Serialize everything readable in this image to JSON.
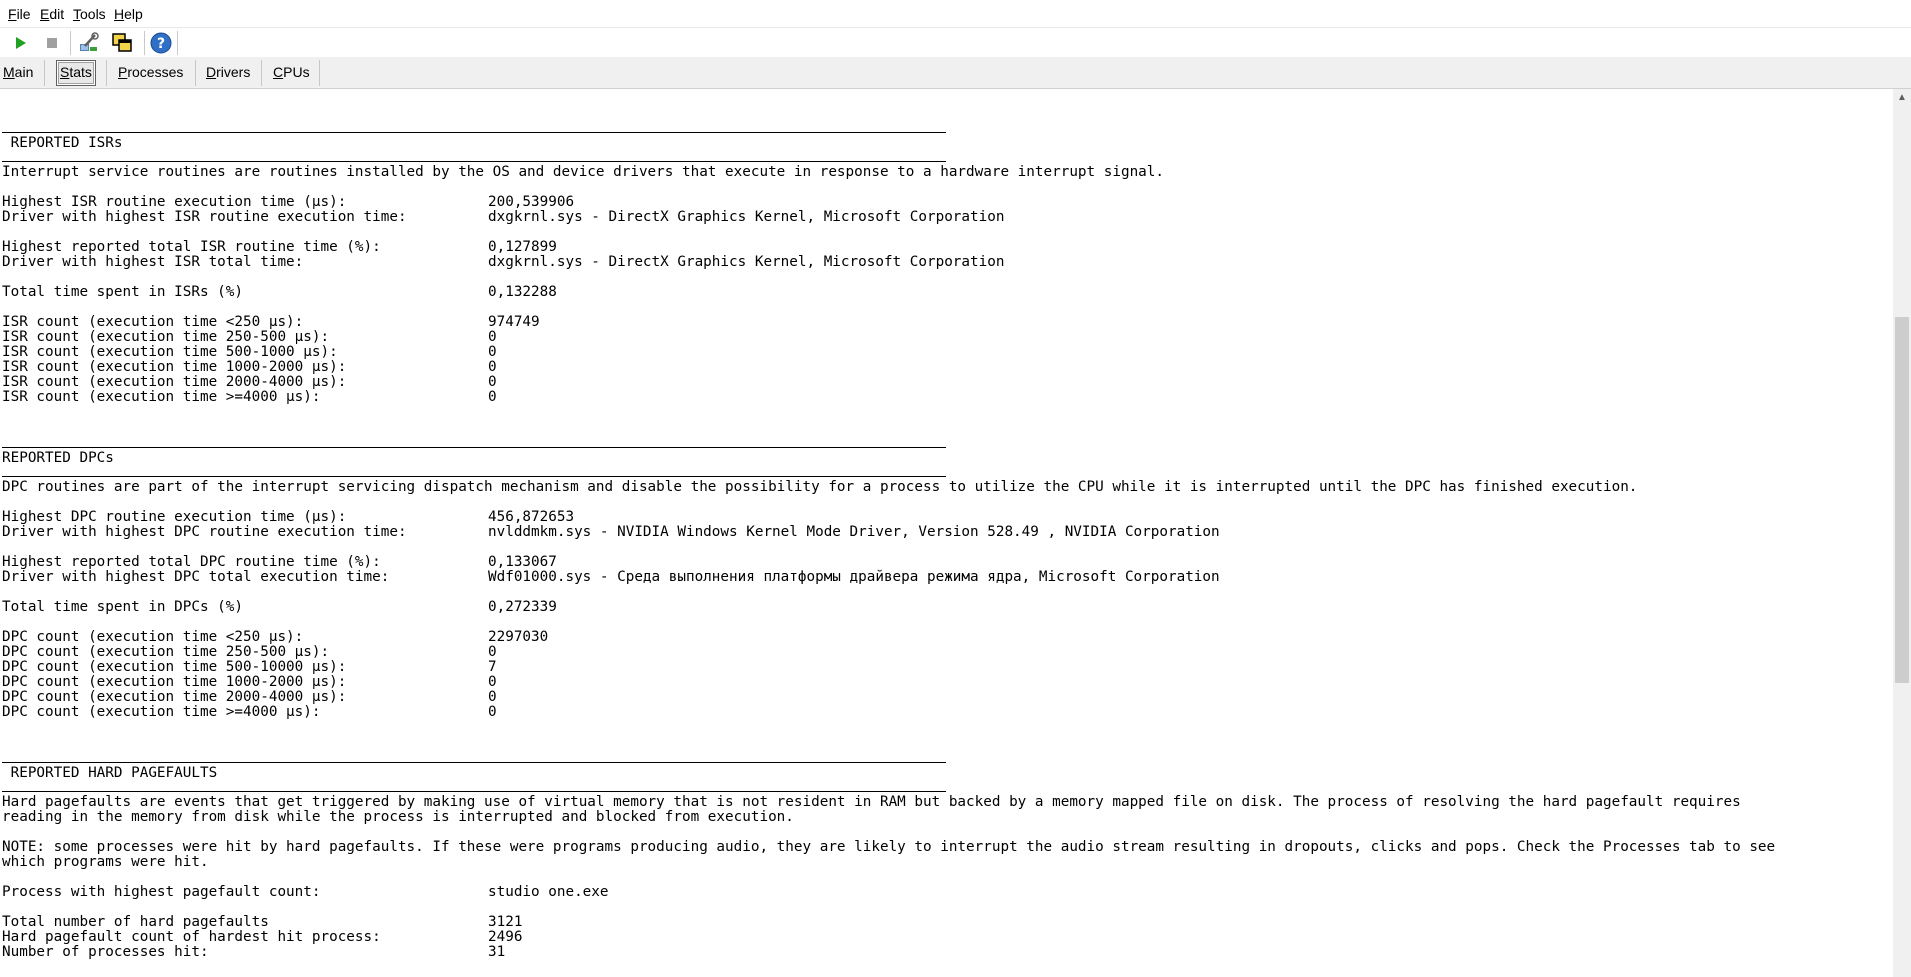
{
  "menu": {
    "file": {
      "accel": "F",
      "rest": "ile"
    },
    "edit": {
      "accel": "E",
      "rest": "dit"
    },
    "tools": {
      "accel": "T",
      "rest": "ools"
    },
    "help": {
      "accel": "H",
      "rest": "elp"
    }
  },
  "tabs": [
    {
      "accel": "M",
      "rest": "ain"
    },
    {
      "accel": "S",
      "rest": "tats"
    },
    {
      "accel": "P",
      "rest": "rocesses"
    },
    {
      "accel": "D",
      "rest": "rivers"
    },
    {
      "accel": "C",
      "rest": "PUs"
    }
  ],
  "isr": {
    "header": " REPORTED ISRs",
    "description": "Interrupt service routines are routines installed by the OS and device drivers that execute in response to a hardware interrupt signal.",
    "rows": [
      {
        "label": "Highest ISR routine execution time (µs):",
        "value": "200,539906"
      },
      {
        "label": "Driver with highest ISR routine execution time:",
        "value": "dxgkrnl.sys - DirectX Graphics Kernel, Microsoft Corporation"
      },
      {
        "label": "Highest reported total ISR routine time (%):",
        "value": "0,127899"
      },
      {
        "label": "Driver with highest ISR total time:",
        "value": "dxgkrnl.sys - DirectX Graphics Kernel, Microsoft Corporation"
      },
      {
        "label": "Total time spent in ISRs (%)",
        "value": "0,132288"
      },
      {
        "label": "ISR count (execution time <250 µs):",
        "value": "974749"
      },
      {
        "label": "ISR count (execution time 250-500 µs):",
        "value": "0"
      },
      {
        "label": "ISR count (execution time 500-1000 µs):",
        "value": "0"
      },
      {
        "label": "ISR count (execution time 1000-2000 µs):",
        "value": "0"
      },
      {
        "label": "ISR count (execution time 2000-4000 µs):",
        "value": "0"
      },
      {
        "label": "ISR count (execution time >=4000 µs):",
        "value": "0"
      }
    ]
  },
  "dpc": {
    "header": "REPORTED DPCs",
    "description": "DPC routines are part of the interrupt servicing dispatch mechanism and disable the possibility for a process to utilize the CPU while it is interrupted until the DPC has finished execution.",
    "rows": [
      {
        "label": "Highest DPC routine execution time (µs):",
        "value": "456,872653"
      },
      {
        "label": "Driver with highest DPC routine execution time:",
        "value": "nvlddmkm.sys - NVIDIA Windows Kernel Mode Driver, Version 528.49 , NVIDIA Corporation"
      },
      {
        "label": "Highest reported total DPC routine time (%):",
        "value": "0,133067"
      },
      {
        "label": "Driver with highest DPC total execution time:",
        "value": "Wdf01000.sys - Среда выполнения платформы драйвера режима ядра, Microsoft Corporation"
      },
      {
        "label": "Total time spent in DPCs (%)",
        "value": "0,272339"
      },
      {
        "label": "DPC count (execution time <250 µs):",
        "value": "2297030"
      },
      {
        "label": "DPC count (execution time 250-500 µs):",
        "value": "0"
      },
      {
        "label": "DPC count (execution time 500-10000 µs):",
        "value": "7"
      },
      {
        "label": "DPC count (execution time 1000-2000 µs):",
        "value": "0"
      },
      {
        "label": "DPC count (execution time 2000-4000 µs):",
        "value": "0"
      },
      {
        "label": "DPC count (execution time >=4000 µs):",
        "value": "0"
      }
    ]
  },
  "pagefaults": {
    "header": " REPORTED HARD PAGEFAULTS",
    "description_1": "Hard pagefaults are events that get triggered by making use of virtual memory that is not resident in RAM but backed by a memory mapped file on disk. The process of resolving the hard pagefault requires",
    "description_2": "reading in the memory from disk while the process is interrupted and blocked from execution.",
    "note_1": "NOTE: some processes were hit by hard pagefaults. If these were programs producing audio, they are likely to interrupt the audio stream resulting in dropouts, clicks and pops. Check the Processes tab to see",
    "note_2": "which programs were hit.",
    "rows": [
      {
        "label": "Process with highest pagefault count:",
        "value": "studio one.exe"
      },
      {
        "label": "Total number of hard pagefaults",
        "value": "3121"
      },
      {
        "label": "Hard pagefault count of hardest hit process:",
        "value": "2496"
      },
      {
        "label": "Number of processes hit:",
        "value": "31"
      }
    ]
  }
}
